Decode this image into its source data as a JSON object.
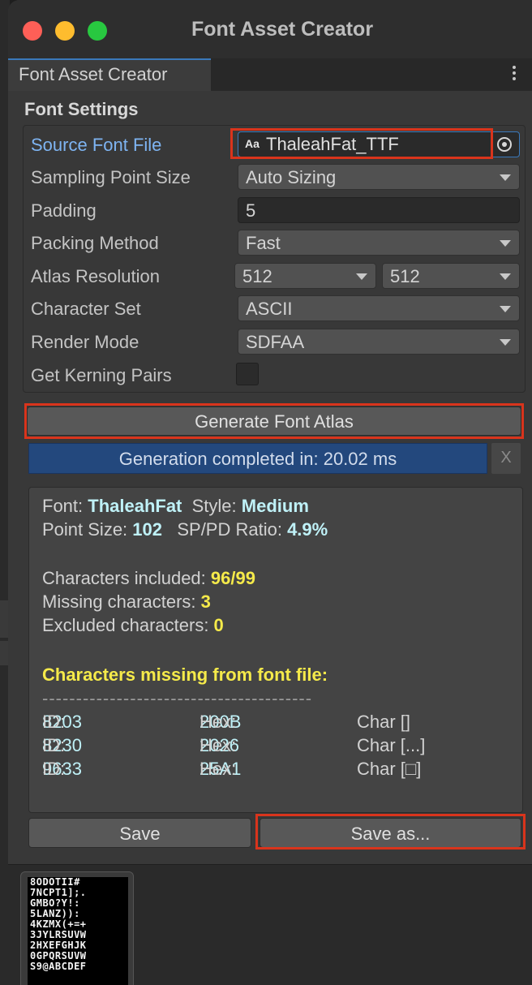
{
  "window": {
    "title": "Font Asset Creator",
    "tab_label": "Font Asset Creator"
  },
  "section_title": "Font Settings",
  "settings": {
    "source_font_file": {
      "label": "Source Font File",
      "value": "ThaleahFat_TTF",
      "icon_text": "Aa"
    },
    "sampling_point_size": {
      "label": "Sampling Point Size",
      "value": "Auto Sizing"
    },
    "padding": {
      "label": "Padding",
      "value": "5"
    },
    "packing_method": {
      "label": "Packing Method",
      "value": "Fast"
    },
    "atlas_resolution": {
      "label": "Atlas Resolution",
      "width": "512",
      "height": "512"
    },
    "character_set": {
      "label": "Character Set",
      "value": "ASCII"
    },
    "render_mode": {
      "label": "Render Mode",
      "value": "SDFAA"
    },
    "get_kerning_pairs": {
      "label": "Get Kerning Pairs",
      "checked": false
    }
  },
  "buttons": {
    "generate": "Generate Font Atlas",
    "dismiss": "X",
    "save": "Save",
    "save_as": "Save as..."
  },
  "status": {
    "message": "Generation completed in: 20.02 ms",
    "progress": 1.0
  },
  "info": {
    "font_label": "Font: ",
    "font_value": "ThaleahFat",
    "style_label": "Style: ",
    "style_value": "Medium",
    "point_size_label": "Point Size: ",
    "point_size_value": "102",
    "ratio_label": "SP/PD Ratio: ",
    "ratio_value": "4.9%",
    "included_label": "Characters included: ",
    "included_value": "96/99",
    "missing_label": "Missing characters: ",
    "missing_value": "3",
    "excluded_label": "Excluded characters: ",
    "excluded_value": "0",
    "missing_title": "Characters missing from font file:",
    "separator": "----------------------------------------",
    "missing_rows": [
      {
        "id_label": "ID: ",
        "id": "8203",
        "hex_label": "Hex: ",
        "hex": "200B",
        "char": "Char []"
      },
      {
        "id_label": "ID: ",
        "id": "8230",
        "hex_label": "Hex: ",
        "hex": "2026",
        "char": "Char [...]"
      },
      {
        "id_label": "ID: ",
        "id": "9633",
        "hex_label": "Hex: ",
        "hex": "25A1",
        "char": "Char [□]"
      }
    ]
  },
  "atlas_preview": {
    "rows": [
      "8ODOTII#",
      "7NCPT1];.",
      "GMBO?Y!:",
      "5LANZ)):",
      "4KZMX(+=+",
      "3JYLRSUVW",
      "2HXEFGHJK",
      "0GPQRSUVW",
      "S9@ABCDEF"
    ]
  },
  "colors": {
    "accent_blue": "#3a79bb",
    "highlight_red": "#d9341c",
    "info_cyan": "#bff1f7",
    "info_yellow": "#f5ea4a",
    "progress_fill": "#23487d"
  }
}
